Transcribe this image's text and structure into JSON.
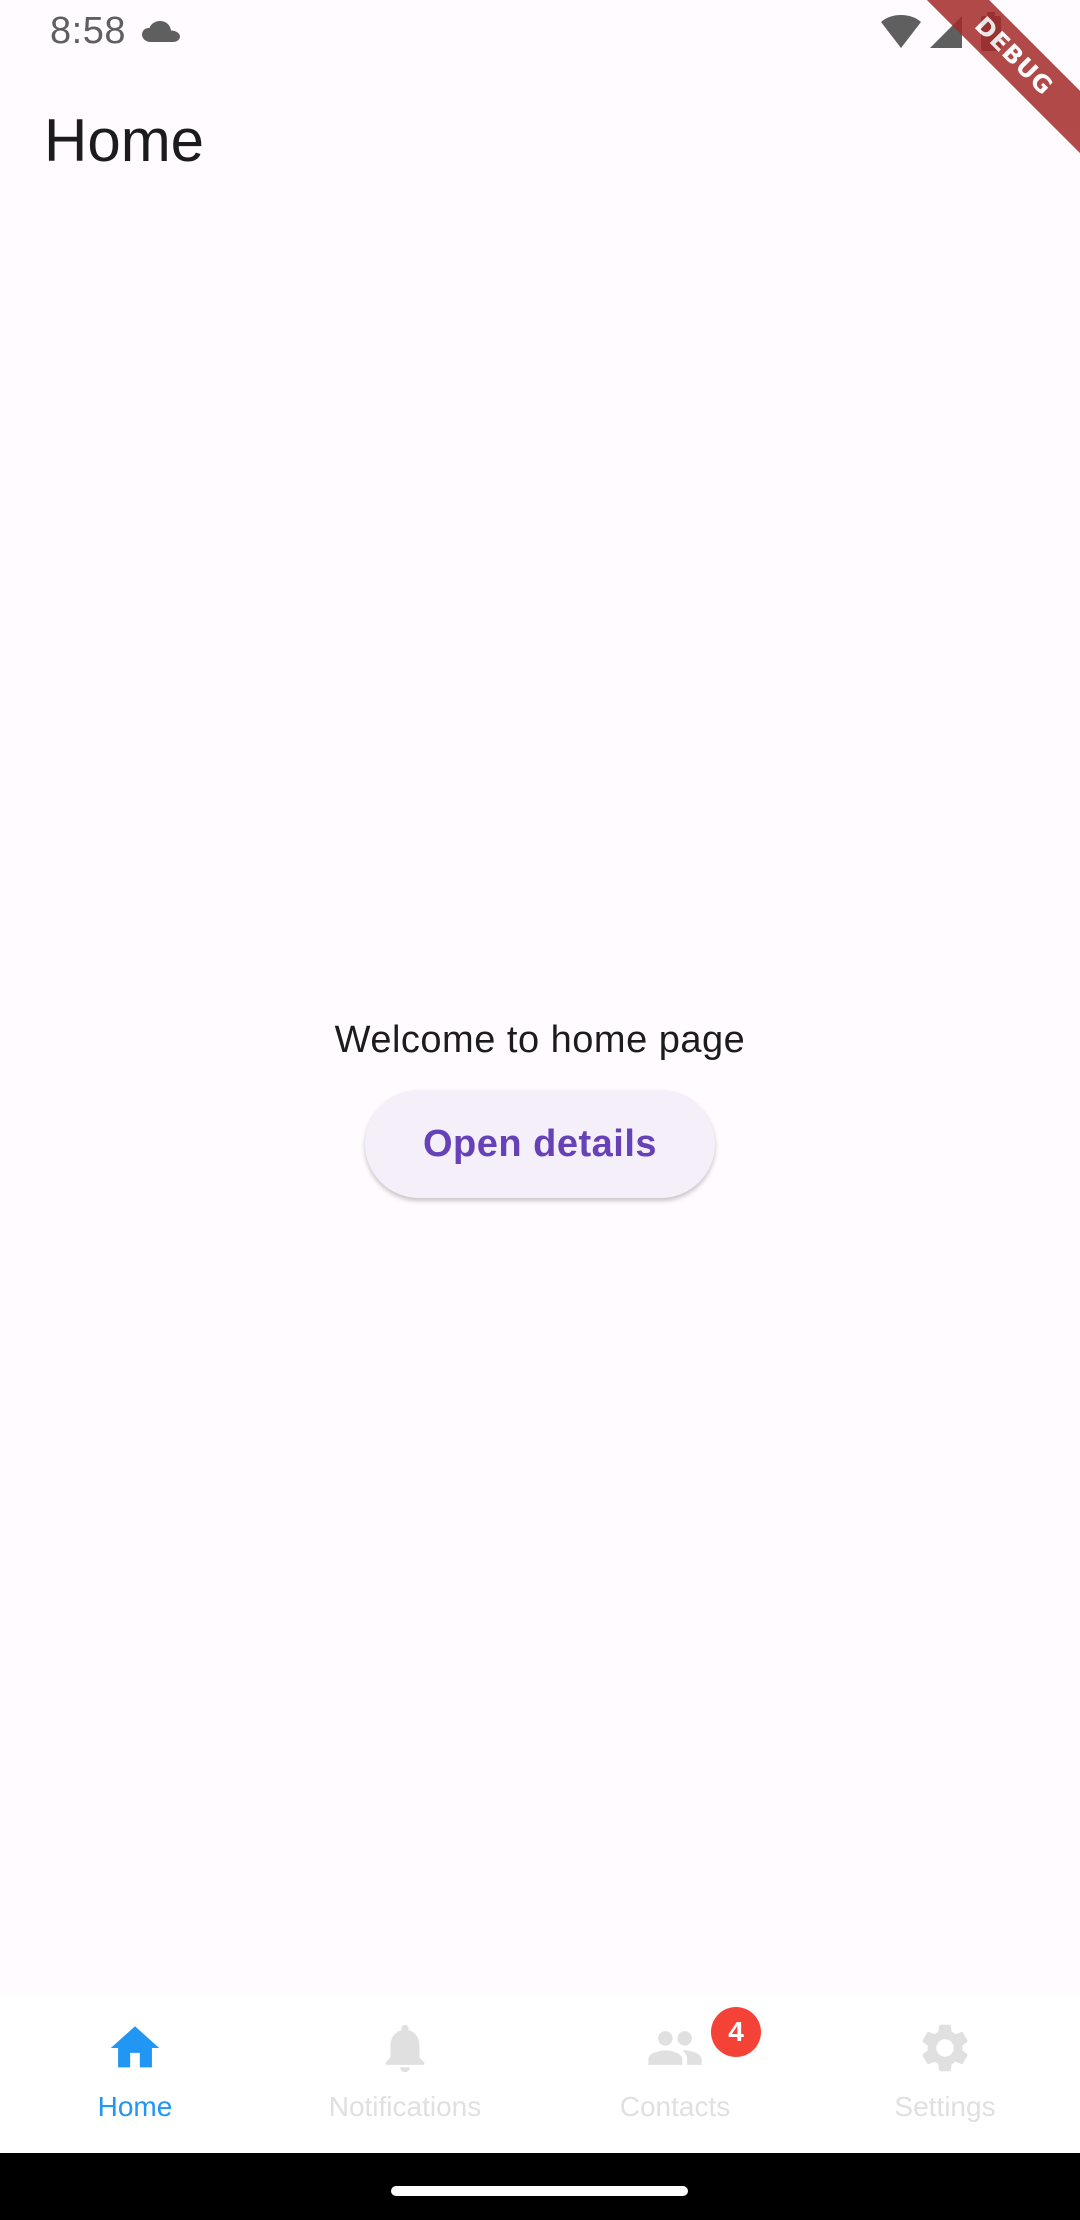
{
  "status_bar": {
    "time": "8:58",
    "icons": [
      "cloud-icon",
      "wifi-icon",
      "signal-icon",
      "battery-icon"
    ]
  },
  "debug_banner": {
    "label": "DEBUG",
    "color": "#a52a2a"
  },
  "app_bar": {
    "title": "Home"
  },
  "body": {
    "welcome_text": "Welcome to home page",
    "open_details_label": "Open details"
  },
  "bottom_nav": {
    "active_color": "#2196f3",
    "inactive_color": "#e0e0e0",
    "items": [
      {
        "label": "Home",
        "icon": "home-icon",
        "active": true
      },
      {
        "label": "Notifications",
        "icon": "bell-icon",
        "active": false
      },
      {
        "label": "Contacts",
        "icon": "people-icon",
        "active": false,
        "badge": "4"
      },
      {
        "label": "Settings",
        "icon": "gear-icon",
        "active": false
      }
    ]
  },
  "colors": {
    "background": "#fffbfe",
    "primary": "#6741b8",
    "badge": "#f44336"
  }
}
